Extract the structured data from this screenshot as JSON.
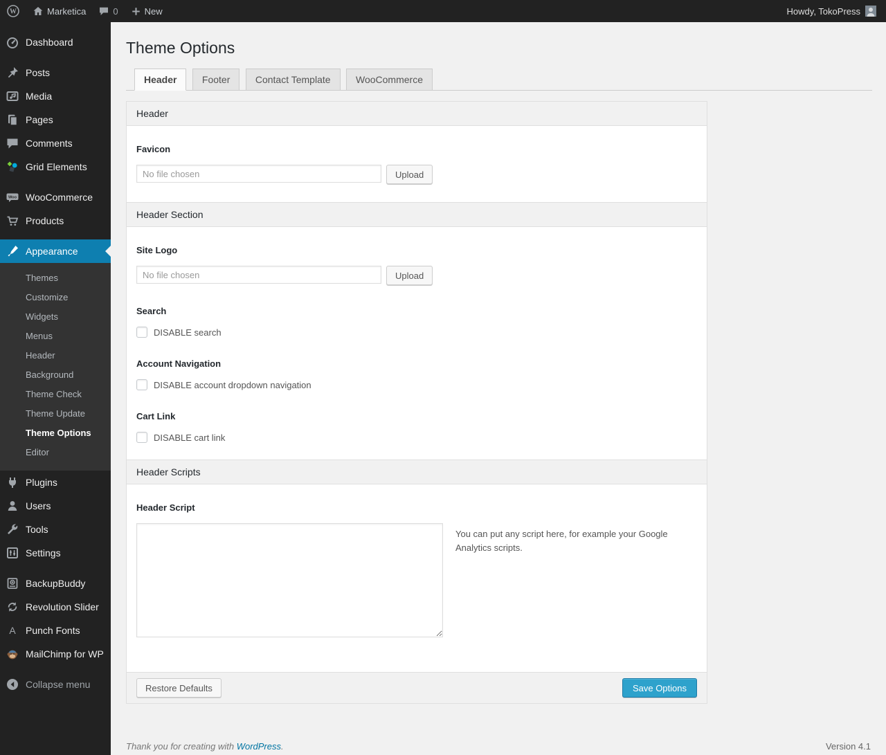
{
  "colors": {
    "accent": "#0e7fb0",
    "primary_button": "#2ea2cc",
    "link": "#0074a2",
    "sidebar_bg": "#222222",
    "admin_bar_bg": "#222222",
    "page_bg": "#f1f1f1"
  },
  "admin_bar": {
    "site_name": "Marketica",
    "comments_count": "0",
    "new_label": "New",
    "howdy": "Howdy, TokoPress"
  },
  "sidebar": {
    "items": [
      {
        "label": "Dashboard",
        "icon": "dashboard-icon"
      },
      {
        "label": "Posts",
        "icon": "pushpin-icon"
      },
      {
        "label": "Media",
        "icon": "media-icon"
      },
      {
        "label": "Pages",
        "icon": "pages-icon"
      },
      {
        "label": "Comments",
        "icon": "comment-icon"
      },
      {
        "label": "Grid Elements",
        "icon": "grid-elements-icon"
      },
      {
        "label": "WooCommerce",
        "icon": "woocommerce-icon"
      },
      {
        "label": "Products",
        "icon": "cart-icon"
      },
      {
        "label": "Appearance",
        "icon": "appearance-brush-icon",
        "active": true
      },
      {
        "label": "Plugins",
        "icon": "plugin-icon"
      },
      {
        "label": "Users",
        "icon": "user-icon"
      },
      {
        "label": "Tools",
        "icon": "wrench-icon"
      },
      {
        "label": "Settings",
        "icon": "settings-icon"
      },
      {
        "label": "BackupBuddy",
        "icon": "backup-icon"
      },
      {
        "label": "Revolution Slider",
        "icon": "rotate-arrows-icon"
      },
      {
        "label": "Punch Fonts",
        "icon": "letter-a-icon"
      },
      {
        "label": "MailChimp for WP",
        "icon": "mailchimp-monkey-icon"
      },
      {
        "label": "Collapse menu",
        "icon": "collapse-arrow-icon"
      }
    ],
    "appearance_submenu": [
      "Themes",
      "Customize",
      "Widgets",
      "Menus",
      "Header",
      "Background",
      "Theme Check",
      "Theme Update",
      "Theme Options",
      "Editor"
    ],
    "current_submenu_item": "Theme Options"
  },
  "page": {
    "title": "Theme Options",
    "tabs": [
      {
        "label": "Header",
        "active": true
      },
      {
        "label": "Footer",
        "active": false
      },
      {
        "label": "Contact Template",
        "active": false
      },
      {
        "label": "WooCommerce",
        "active": false
      }
    ]
  },
  "panel": {
    "header_section_title": "Header",
    "favicon": {
      "label": "Favicon",
      "placeholder": "No file chosen",
      "value": "",
      "button": "Upload"
    },
    "header_area_title": "Header Section",
    "site_logo": {
      "label": "Site Logo",
      "placeholder": "No file chosen",
      "value": "",
      "button": "Upload"
    },
    "search": {
      "label": "Search",
      "checkbox_label": "DISABLE search",
      "checked": false
    },
    "account_navigation": {
      "label": "Account Navigation",
      "checkbox_label": "DISABLE account dropdown navigation",
      "checked": false
    },
    "cart_link": {
      "label": "Cart Link",
      "checkbox_label": "DISABLE cart link",
      "checked": false
    },
    "scripts_section_title": "Header Scripts",
    "header_script": {
      "label": "Header Script",
      "value": "",
      "hint": "You can put any script here, for example your Google Analytics scripts."
    },
    "actions": {
      "restore_label": "Restore Defaults",
      "save_label": "Save Options"
    }
  },
  "footer": {
    "thankyou_prefix": "Thank you for creating with ",
    "thankyou_link": "WordPress",
    "thankyou_suffix": ".",
    "version": "Version 4.1"
  }
}
